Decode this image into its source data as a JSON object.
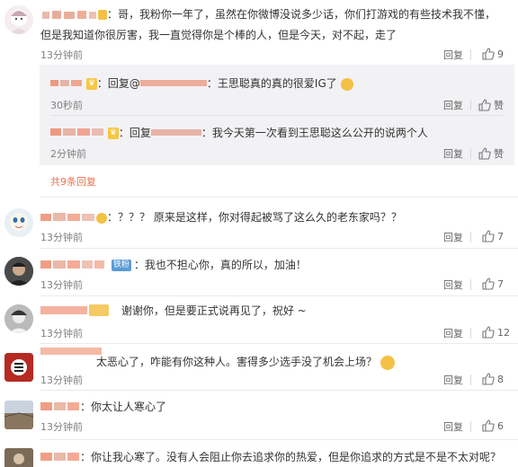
{
  "colors": {
    "accent": "#eb7350",
    "muted": "#808080",
    "sub_bg": "#f2f2f5"
  },
  "comments": [
    {
      "text": "：哥，我粉你一年了，虽然在你微博没说多少话，你们打游戏的有些技术我不懂，",
      "text2": "但是我知道你很厉害，我一直觉得你是个棒的人，但是今天，对不起，走了",
      "time": "13分钟前",
      "reply": "回复",
      "likes": "9"
    },
    {
      "text": "：？？？ 原来是这样，你对得起被骂了这么久的老东家吗？？",
      "time": "13分钟前",
      "reply": "回复",
      "likes": "7"
    },
    {
      "badge": "铁粉",
      "text": "我也不担心你，真的所以，加油！",
      "time": "13分钟前",
      "reply": "回复",
      "likes": "7"
    },
    {
      "text": "谢谢你，但是要正式说再见了，祝好 ~",
      "time": "13分钟前",
      "reply": "回复",
      "likes": "12"
    },
    {
      "text": "太恶心了，咋能有你这种人。害得多少选手没了机会上场？",
      "time": "13分钟前",
      "reply": "回复",
      "likes": "8"
    },
    {
      "text": "你太让人寒心了",
      "time": "13分钟前",
      "reply": "回复",
      "likes": "6"
    },
    {
      "text": "你让我心寒了。没有人会阻止你去追求你的热爱，但是你追求的方式是不是不太对呢？"
    }
  ],
  "subreplies": [
    {
      "prefix": "：回复@",
      "text": "：王思聪真的真的很爱IG了",
      "time": "30秒前",
      "reply": "回复",
      "likes": "赞"
    },
    {
      "prefix": "：回复",
      "text": "：我今天第一次看到王思聪这么公开的说两个人",
      "time": "2分钟前",
      "reply": "回复",
      "likes": "赞"
    }
  ],
  "more_replies": "共9条回复"
}
